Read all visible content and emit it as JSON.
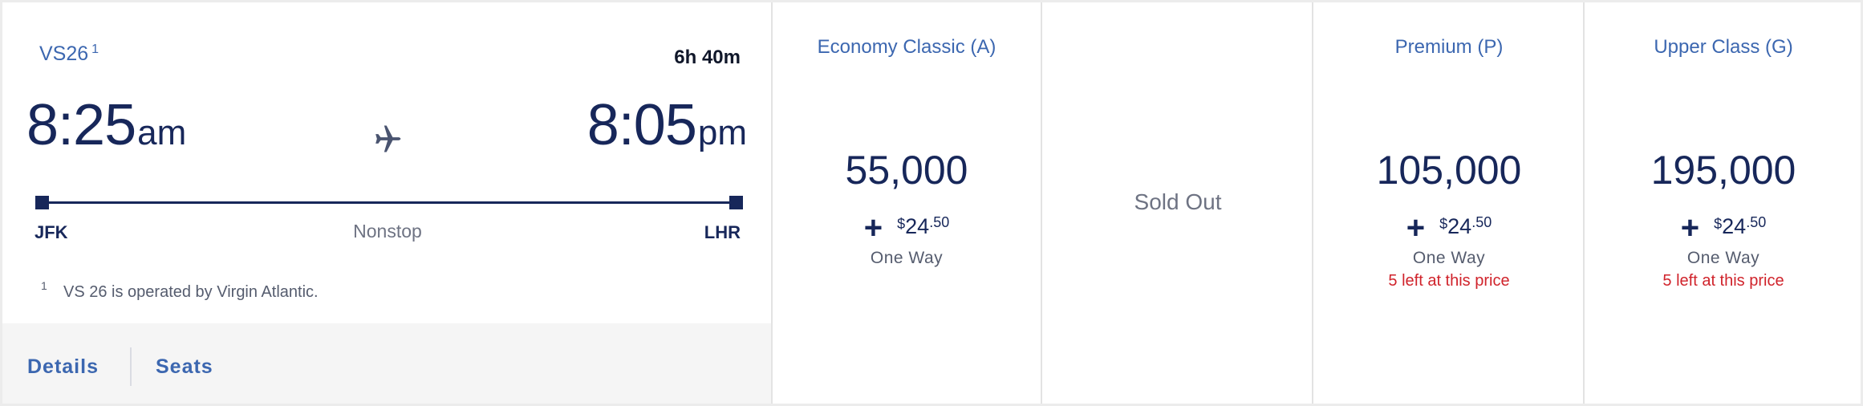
{
  "flight": {
    "number": "VS26",
    "footnote_marker": "1",
    "duration": "6h 40m",
    "departure": {
      "time": "8:25",
      "suffix": "am",
      "airport": "JFK"
    },
    "arrival": {
      "time": "8:05",
      "suffix": "pm",
      "airport": "LHR"
    },
    "stops": "Nonstop",
    "footnote": {
      "marker": "1",
      "text": "VS 26 is operated by Virgin Atlantic."
    },
    "icons": {
      "plane": "airplane-icon"
    }
  },
  "actions": {
    "details": "Details",
    "seats": "Seats"
  },
  "fares": [
    {
      "title": "Economy Classic (A)",
      "sold_out": false,
      "miles": "55,000",
      "plus": "+",
      "fee_dollar": "$",
      "fee_whole": "24",
      "fee_cents": ".50",
      "trip": "One Way",
      "availability": ""
    },
    {
      "title": "",
      "sold_out": true,
      "status": "Sold Out"
    },
    {
      "title": "Premium (P)",
      "sold_out": false,
      "miles": "105,000",
      "plus": "+",
      "fee_dollar": "$",
      "fee_whole": "24",
      "fee_cents": ".50",
      "trip": "One Way",
      "availability": "5 left at this price"
    },
    {
      "title": "Upper Class (G)",
      "sold_out": false,
      "miles": "195,000",
      "plus": "+",
      "fee_dollar": "$",
      "fee_whole": "24",
      "fee_cents": ".50",
      "trip": "One Way",
      "availability": "5 left at this price"
    }
  ],
  "colors": {
    "accent_blue": "#3c67b0",
    "navy": "#17275a",
    "availability_red": "#d0232b",
    "muted_gray": "#6e7383"
  }
}
